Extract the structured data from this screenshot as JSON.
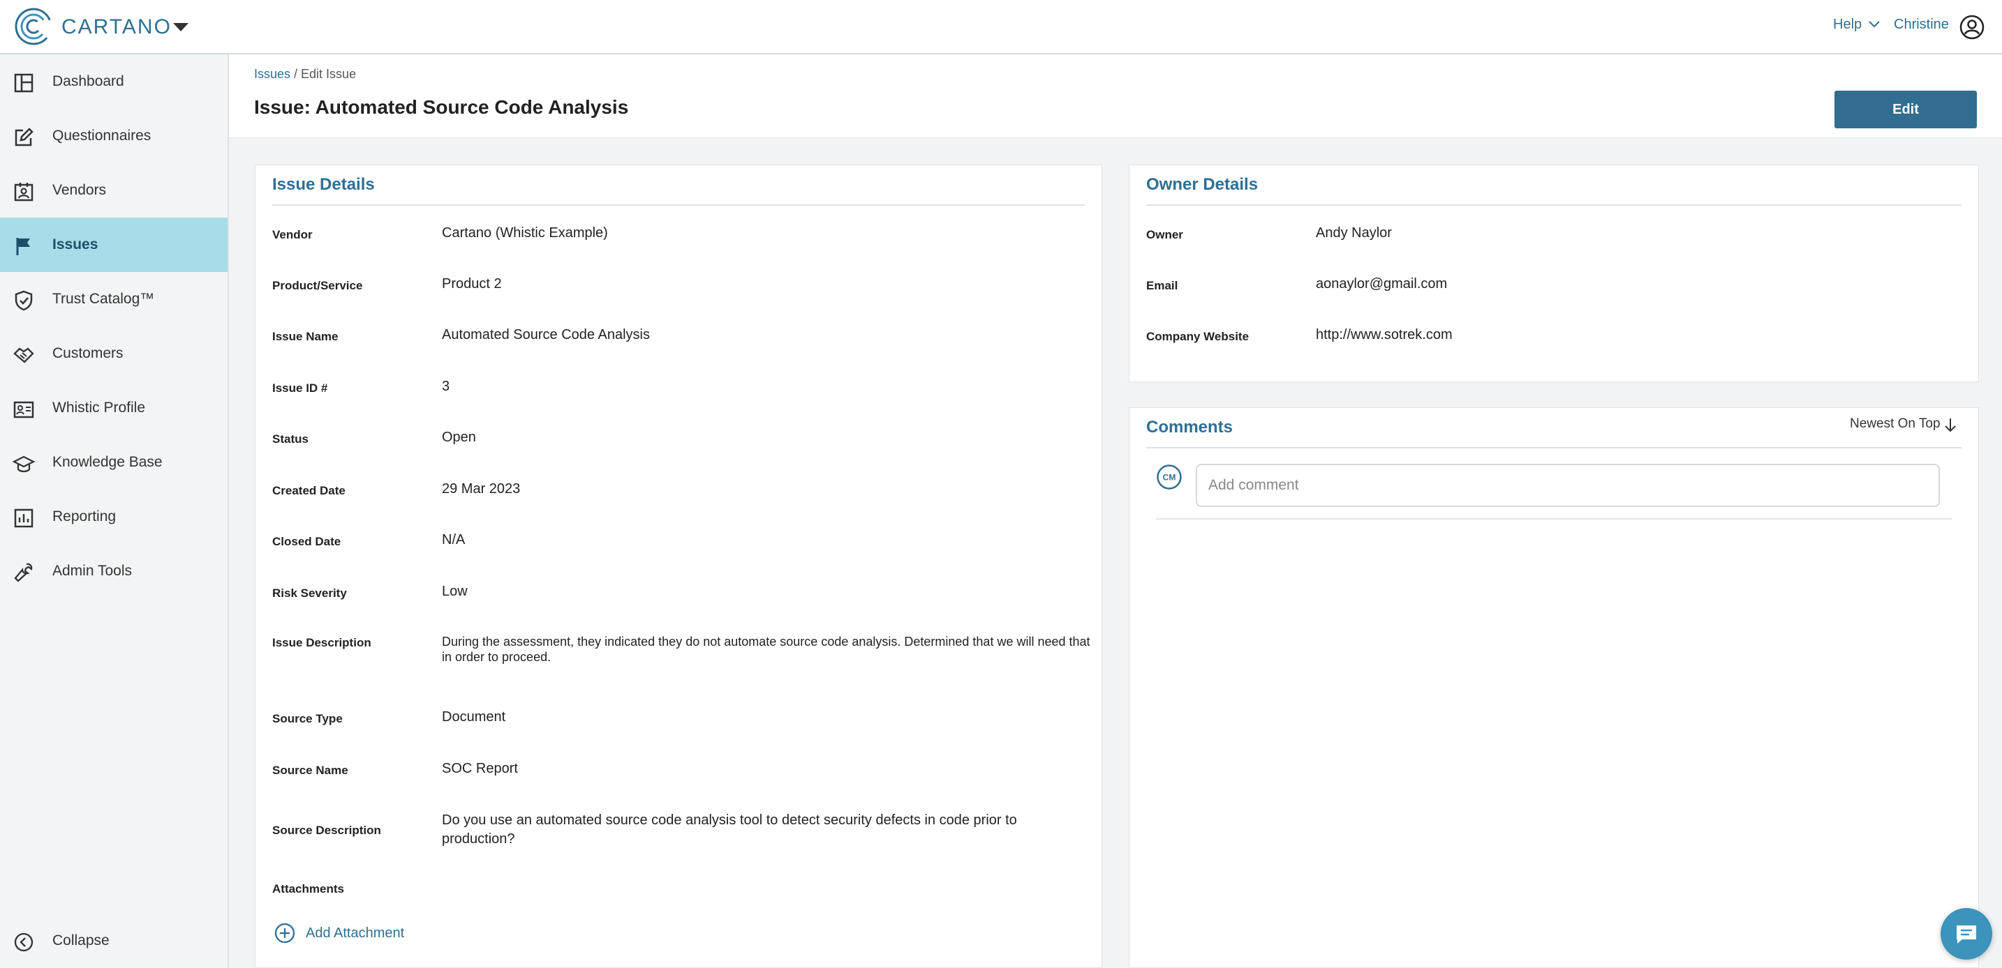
{
  "app": {
    "brand": "CARTANO",
    "help_label": "Help",
    "user_name": "Christine"
  },
  "sidebar": {
    "items": [
      {
        "label": "Dashboard",
        "icon": "dashboard-icon"
      },
      {
        "label": "Questionnaires",
        "icon": "edit-square-icon"
      },
      {
        "label": "Vendors",
        "icon": "vendor-card-icon"
      },
      {
        "label": "Issues",
        "icon": "flag-icon"
      },
      {
        "label": "Trust Catalog™",
        "icon": "shield-check-icon"
      },
      {
        "label": "Customers",
        "icon": "handshake-icon"
      },
      {
        "label": "Whistic Profile",
        "icon": "profile-card-icon"
      },
      {
        "label": "Knowledge Base",
        "icon": "graduation-cap-icon"
      },
      {
        "label": "Reporting",
        "icon": "bar-chart-icon"
      },
      {
        "label": "Admin Tools",
        "icon": "wrench-icon"
      }
    ],
    "active_item": "Issues",
    "collapse_label": "Collapse"
  },
  "header": {
    "breadcrumb_link": "Issues",
    "breadcrumb_current": " / Edit Issue",
    "title": "Issue: Automated Source Code Analysis",
    "edit_label": "Edit"
  },
  "issue_details": {
    "title": "Issue Details",
    "fields": [
      {
        "label": "Vendor",
        "value": "Cartano (Whistic Example)"
      },
      {
        "label": "Product/Service",
        "value": "Product 2"
      },
      {
        "label": "Issue Name",
        "value": "Automated Source Code Analysis"
      },
      {
        "label": "Issue ID #",
        "value": "3"
      },
      {
        "label": "Status",
        "value": "Open"
      },
      {
        "label": "Created Date",
        "value": "29 Mar 2023"
      },
      {
        "label": "Closed Date",
        "value": "N/A"
      },
      {
        "label": "Risk Severity",
        "value": "Low"
      },
      {
        "label": "Issue Description",
        "value": "During the assessment, they indicated they do not automate source code analysis. Determined that we will need that in order to proceed."
      },
      {
        "label": "Source Type",
        "value": "Document"
      },
      {
        "label": "Source Name",
        "value": "SOC Report"
      },
      {
        "label": "Source Description",
        "value": "Do you use an automated source code analysis tool to detect security defects in code prior to production?"
      },
      {
        "label": "Attachments",
        "value": ""
      }
    ],
    "add_attachment_label": "Add Attachment"
  },
  "owner_details": {
    "title": "Owner Details",
    "fields": [
      {
        "label": "Owner",
        "value": "Andy Naylor"
      },
      {
        "label": "Email",
        "value": "aonaylor@gmail.com"
      },
      {
        "label": "Company Website",
        "value": "http://www.sotrek.com"
      }
    ]
  },
  "comments": {
    "title": "Comments",
    "sort_label": "Newest On Top",
    "avatar_initials": "CM",
    "input_placeholder": "Add comment"
  },
  "colors": {
    "accent": "#2e6f93",
    "active_nav": "#a8dce9",
    "edit_button": "#316d8f",
    "chat_button": "#3c93bb"
  }
}
